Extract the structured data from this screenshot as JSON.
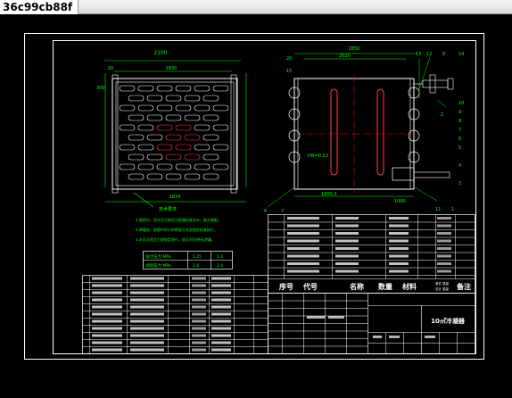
{
  "window": {
    "tab_title": "36c99cb88f"
  },
  "drawing": {
    "title_block": {
      "name": "10㎡冷凝器"
    },
    "bom_headers": [
      "序号",
      "代号",
      "名称",
      "数量",
      "材料",
      "单件 重量",
      "总计 重量",
      "备注"
    ],
    "notes_title": "技术要求",
    "notes": [
      "1.管程内，设计压力按压力容器标准设计，按大图制。",
      "2.焊缝处，按图中所示的焊接方式及相应标准执行。",
      "3.水压试验压力按规定进行，保压30分钟无渗漏。"
    ],
    "pressure_table": {
      "rows": [
        [
          "设计压力 MPa",
          "1.25",
          "1.6"
        ],
        [
          "试验压力 MPa",
          "1.8",
          "2.0"
        ]
      ]
    },
    "dims_front": {
      "top": "2100",
      "top_sub": "20",
      "width": "1830",
      "left": "300",
      "bottom": "1834"
    },
    "dims_side": {
      "top": "2850",
      "top_sub": "2020",
      "bottom": "1800.3",
      "label": "DN=0.12"
    }
  }
}
